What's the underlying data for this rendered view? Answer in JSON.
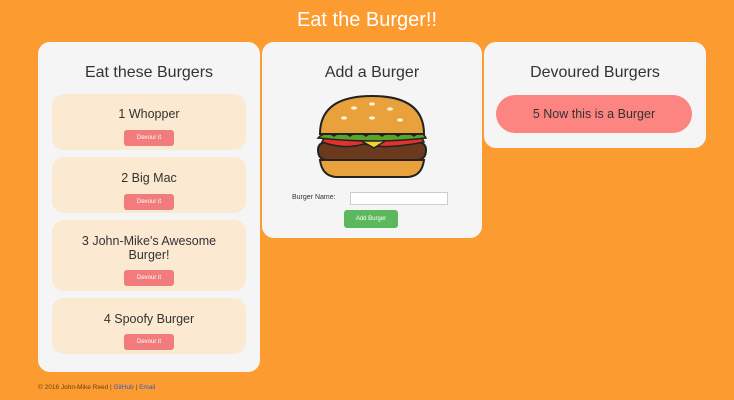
{
  "header": {
    "title": "Eat the Burger!!"
  },
  "eat_panel": {
    "title": "Eat these Burgers",
    "burgers": [
      {
        "id": "1",
        "name": "Whopper",
        "button": "Devour it"
      },
      {
        "id": "2",
        "name": "Big Mac",
        "button": "Devour it"
      },
      {
        "id": "3",
        "name": "John-Mike's Awesome Burger!",
        "button": "Devour it"
      },
      {
        "id": "4",
        "name": "Spoofy Burger",
        "button": "Devour it"
      }
    ]
  },
  "add_panel": {
    "title": "Add a Burger",
    "form_label": "Burger Name:",
    "input_value": "",
    "submit_label": "Add Burger"
  },
  "devoured_panel": {
    "title": "Devoured Burgers",
    "items": [
      {
        "id": "5",
        "name": "Now this is a Burger"
      }
    ]
  },
  "footer": {
    "text": "© 2016 John-Mike Reed",
    "link_1": "GitHub",
    "link_2": "Email"
  },
  "colors": {
    "background": "#fc9b2f",
    "panel": "#f5f5f5",
    "card": "#fbe9d2",
    "devour_button": "#f27b7b",
    "add_button": "#5cb85c",
    "devoured_item": "#fc8582"
  }
}
